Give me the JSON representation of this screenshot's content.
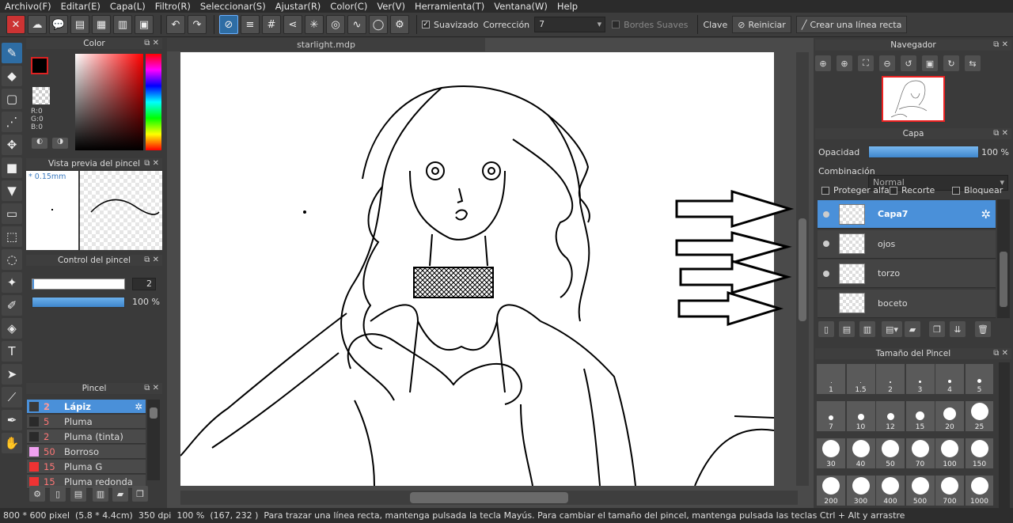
{
  "menu": [
    "Archivo(F)",
    "Editar(E)",
    "Capa(L)",
    "Filtro(R)",
    "Seleccionar(S)",
    "Ajustar(R)",
    "Color(C)",
    "Ver(V)",
    "Herramienta(T)",
    "Ventana(W)",
    "Help"
  ],
  "toolbar": {
    "antialias_label": "Suavizado",
    "correction_label": "Corrección",
    "correction_value": "7",
    "soft_edges_label": "Bordes Suaves",
    "key_label": "Clave",
    "reset_label": "Reiniciar",
    "straight_line_label": "Crear una línea recta"
  },
  "color_panel": {
    "title": "Color",
    "r": "R:0",
    "g": "G:0",
    "b": "B:0"
  },
  "brush_preview": {
    "title": "Vista previa del pincel",
    "size": "* 0.15mm"
  },
  "brush_control": {
    "title": "Control del pincel",
    "size_value": "2",
    "opacity_value": "100 %"
  },
  "brush_panel": {
    "title": "Pincel",
    "items": [
      {
        "size": "2",
        "name": "Lápiz",
        "color": "#3a3a3a"
      },
      {
        "size": "5",
        "name": "Pluma",
        "color": "#2a2a2a"
      },
      {
        "size": "2",
        "name": "Pluma (tinta)",
        "color": "#2a2a2a"
      },
      {
        "size": "50",
        "name": "Borroso",
        "color": "#f0a0f0"
      },
      {
        "size": "15",
        "name": "Pluma G",
        "color": "#e33"
      },
      {
        "size": "15",
        "name": "Pluma redonda",
        "color": "#e33"
      }
    ]
  },
  "document": {
    "tab_title": "starlight.mdp"
  },
  "navigator": {
    "title": "Navegador"
  },
  "layer_panel": {
    "title": "Capa",
    "opacity_label": "Opacidad",
    "opacity_value": "100 %",
    "blend_label": "Combinación",
    "blend_value": "Normal",
    "protect_alpha": "Proteger alfa",
    "clipping": "Recorte",
    "lock": "Bloquear",
    "layers": [
      {
        "name": "Capa7",
        "visible": true,
        "selected": true
      },
      {
        "name": "ojos",
        "visible": true,
        "selected": false
      },
      {
        "name": "torzo",
        "visible": true,
        "selected": false
      },
      {
        "name": "boceto",
        "visible": false,
        "selected": false
      }
    ]
  },
  "brush_size_panel": {
    "title": "Tamaño del Pincel",
    "sizes": [
      "1",
      "1.5",
      "2",
      "3",
      "4",
      "5",
      "7",
      "10",
      "12",
      "15",
      "20",
      "25",
      "30",
      "40",
      "50",
      "70",
      "100",
      "150",
      "200",
      "300",
      "400",
      "500",
      "700",
      "1000"
    ]
  },
  "status": {
    "dimensions": "800 * 600 pixel",
    "physical": "(5.8 * 4.4cm)",
    "dpi": "350 dpi",
    "zoom": "100 %",
    "cursor": "(167, 232 )",
    "hint": "Para trazar una línea recta, mantenga pulsada la tecla Mayús. Para cambiar el tamaño del pincel, mantenga pulsada las teclas Ctrl + Alt y arrastre"
  },
  "colors": {
    "accent": "#4a90d9",
    "selected_tool": "#2e6da4",
    "close_red": "#cc3333"
  }
}
